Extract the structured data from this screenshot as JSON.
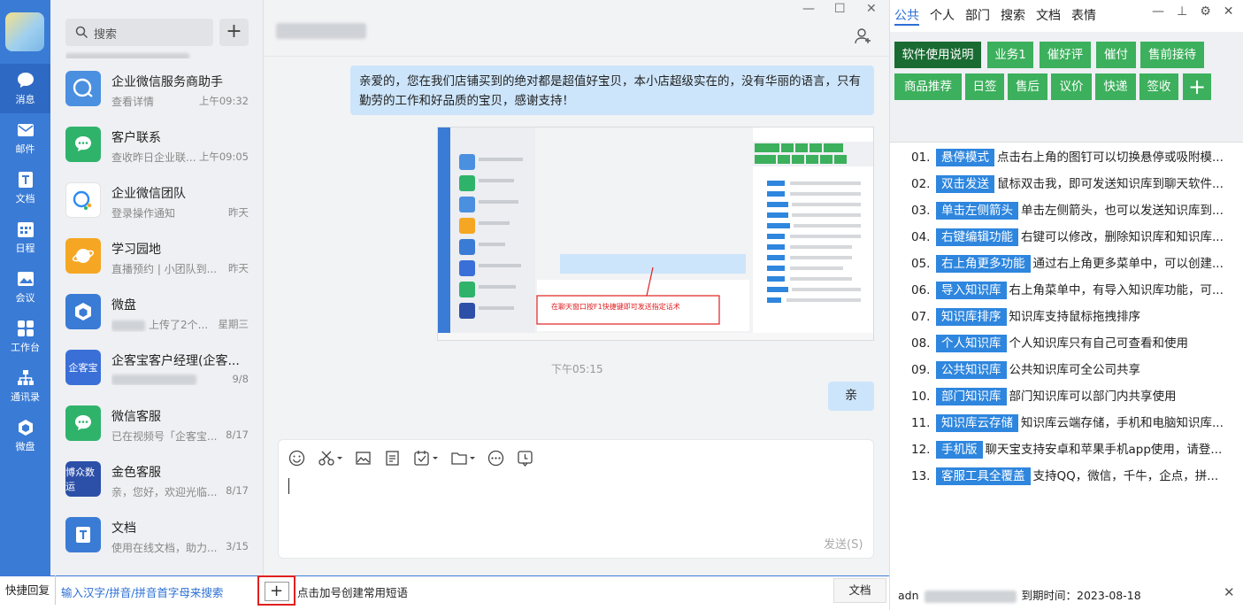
{
  "nav": {
    "items": [
      {
        "label": "消息",
        "icon": "message-icon"
      },
      {
        "label": "邮件",
        "icon": "mail-icon"
      },
      {
        "label": "文档",
        "icon": "document-icon"
      },
      {
        "label": "日程",
        "icon": "calendar-icon"
      },
      {
        "label": "会议",
        "icon": "meeting-icon"
      },
      {
        "label": "工作台",
        "icon": "workbench-icon"
      },
      {
        "label": "通讯录",
        "icon": "contacts-icon"
      },
      {
        "label": "微盘",
        "icon": "drive-icon"
      }
    ]
  },
  "search": {
    "placeholder": "搜索"
  },
  "chats": [
    {
      "name": "企业微信服务商助手",
      "preview": "查看详情",
      "time": "上午09:32",
      "color": "#4a8fe0"
    },
    {
      "name": "客户联系",
      "preview": "查收昨日企业联...",
      "time": "上午09:05",
      "color": "#2fb36b"
    },
    {
      "name": "企业微信团队",
      "preview": "登录操作通知",
      "time": "昨天",
      "color": "#ffffff"
    },
    {
      "name": "学习园地",
      "preview": "直播预约 | 小团队到...",
      "time": "昨天",
      "color": "#f5a623"
    },
    {
      "name": "微盘",
      "preview": "上传了2个...",
      "time": "星期三",
      "color": "#3a7bd5"
    },
    {
      "name": "企客宝客户经理(企客...",
      "preview": "",
      "time": "9/8",
      "color": "#3a6fd8",
      "badge": "企客宝"
    },
    {
      "name": "微信客服",
      "preview": "已在视频号「企客宝...",
      "time": "8/17",
      "color": "#2fb36b"
    },
    {
      "name": "金色客服",
      "preview": "亲，您好，欢迎光临...",
      "time": "8/17",
      "color": "#2c4fa8",
      "badge": "博众数运"
    },
    {
      "name": "文档",
      "preview": "使用在线文档，助力...",
      "time": "3/15",
      "color": "#3a7bd5"
    }
  ],
  "message": {
    "text": "亲爱的，您在我们店铺买到的绝对都是超值好宝贝，本小店超级实在的，没有华丽的语言，只有勤劳的工作和好品质的宝贝，感谢支持！",
    "time": "下午05:15",
    "reply": "亲"
  },
  "screenshot": {
    "annotation": "在聊天窗口按F1快捷键即可发送指定话术"
  },
  "editor": {
    "send_label": "发送(S)"
  },
  "bottom": {
    "quick_reply": "快捷回复",
    "hint": "输入汉字/拼音/拼音首字母来搜索",
    "add_label": "点击加号创建常用短语",
    "doc_button": "文档"
  },
  "right": {
    "tabs": [
      "公共",
      "个人",
      "部门",
      "搜索",
      "文档",
      "表情"
    ],
    "buttons": [
      "软件使用说明",
      "业务1",
      "催好评",
      "催付",
      "售前接待",
      "商品推荐",
      "日签",
      "售后",
      "议价",
      "快递",
      "签收"
    ],
    "items": [
      {
        "num": "01.",
        "tag": "悬停模式",
        "text": "点击右上角的图钉可以切换悬停或吸附模..."
      },
      {
        "num": "02.",
        "tag": "双击发送",
        "text": "鼠标双击我，即可发送知识库到聊天软件..."
      },
      {
        "num": "03.",
        "tag": "单击左侧箭头",
        "text": "单击左侧箭头，也可以发送知识库到..."
      },
      {
        "num": "04.",
        "tag": "右键编辑功能",
        "text": "右键可以修改，删除知识库和知识库..."
      },
      {
        "num": "05.",
        "tag": "右上角更多功能",
        "text": "通过右上角更多菜单中，可以创建..."
      },
      {
        "num": "06.",
        "tag": "导入知识库",
        "text": "右上角菜单中，有导入知识库功能，可..."
      },
      {
        "num": "07.",
        "tag": "知识库排序",
        "text": "知识库支持鼠标拖拽排序"
      },
      {
        "num": "08.",
        "tag": "个人知识库",
        "text": "个人知识库只有自己可查看和使用"
      },
      {
        "num": "09.",
        "tag": "公共知识库",
        "text": "公共知识库可全公司共享"
      },
      {
        "num": "10.",
        "tag": "部门知识库",
        "text": "部门知识库可以部门内共享使用"
      },
      {
        "num": "11.",
        "tag": "知识库云存储",
        "text": "知识库云端存储，手机和电脑知识库..."
      },
      {
        "num": "12.",
        "tag": "手机版",
        "text": "聊天宝支持安卓和苹果手机app使用，请登..."
      },
      {
        "num": "13.",
        "tag": "客服工具全覆盖",
        "text": "支持QQ，微信，千牛，企点，拼..."
      }
    ],
    "account_prefix": "adn",
    "expiry": "到期时间：2023-08-18"
  }
}
